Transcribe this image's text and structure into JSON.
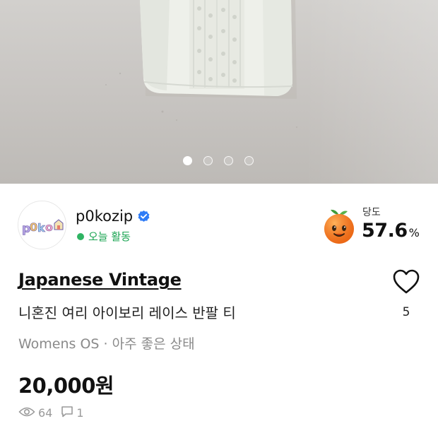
{
  "gallery": {
    "image_alt": "White lace short sleeve top",
    "page_count": 4,
    "active_index": 0
  },
  "seller": {
    "name": "p0kozip",
    "avatar_text": "p0ko",
    "status": "오늘 활동",
    "verified": true,
    "temperature_label": "당도",
    "temperature_value": "57.6",
    "temperature_unit": "%"
  },
  "product": {
    "brand": "Japanese Vintage",
    "title": "니혼진 여리 아이보리 레이스 반팔 티",
    "meta": "Womens OS · 아주 좋은 상태",
    "price": "20,000원"
  },
  "likes": {
    "count": "5"
  },
  "stats": {
    "views": "64",
    "comments": "1"
  },
  "colors": {
    "status_green": "#1aa452",
    "verified_blue": "#2f7cf6",
    "muted": "#8a8a8a"
  }
}
